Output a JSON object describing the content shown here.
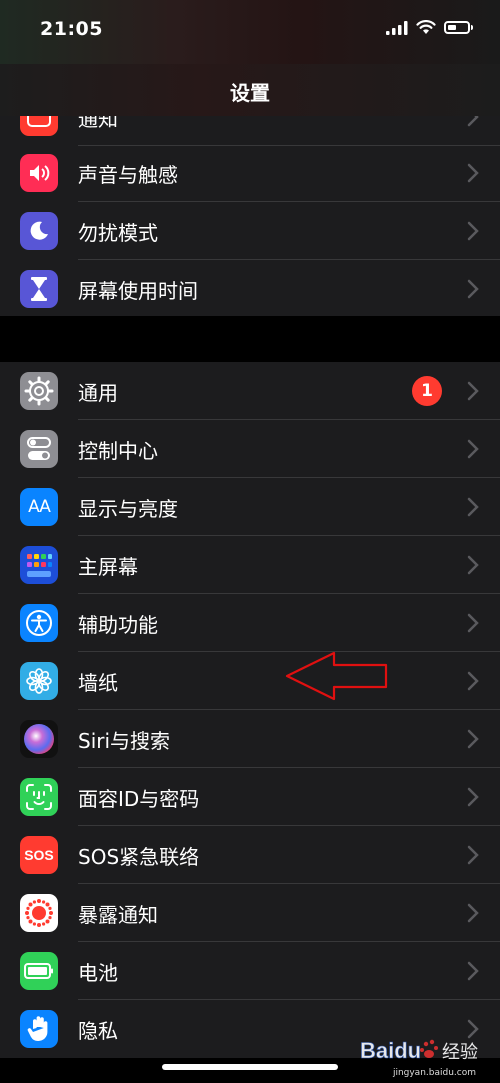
{
  "status_bar": {
    "time": "21:05"
  },
  "nav": {
    "title": "设置"
  },
  "group1": [
    {
      "label": "通知",
      "color": "#ff3b30",
      "icon": "notifications-icon"
    },
    {
      "label": "声音与触感",
      "color": "#ff2d55",
      "icon": "speaker-icon"
    },
    {
      "label": "勿扰模式",
      "color": "#5856d6",
      "icon": "moon-icon"
    },
    {
      "label": "屏幕使用时间",
      "color": "#5856d6",
      "icon": "hourglass-icon"
    }
  ],
  "group2": [
    {
      "label": "通用",
      "color": "#8e8e93",
      "icon": "gear-icon",
      "badge": "1"
    },
    {
      "label": "控制中心",
      "color": "#8e8e93",
      "icon": "toggles-icon"
    },
    {
      "label": "显示与亮度",
      "color": "#0a84ff",
      "icon": "text-size-icon",
      "icon_text": "AA"
    },
    {
      "label": "主屏幕",
      "color": "#1d4ed8",
      "icon": "home-screen-icon"
    },
    {
      "label": "辅助功能",
      "color": "#0a84ff",
      "icon": "accessibility-icon"
    },
    {
      "label": "墙纸",
      "color": "#32ade6",
      "icon": "flower-icon"
    },
    {
      "label": "Siri与搜索",
      "color": "#1a1a2e",
      "icon": "siri-icon"
    },
    {
      "label": "面容ID与密码",
      "color": "#30d158",
      "icon": "face-id-icon"
    },
    {
      "label": "SOS紧急联络",
      "color": "#ff3b30",
      "icon": "sos-icon",
      "icon_text": "SOS"
    },
    {
      "label": "暴露通知",
      "color": "#ffffff",
      "icon": "exposure-icon"
    },
    {
      "label": "电池",
      "color": "#30d158",
      "icon": "battery-icon"
    },
    {
      "label": "隐私",
      "color": "#0a84ff",
      "icon": "hand-icon"
    }
  ],
  "annotation": {
    "color": "#e01010",
    "icon": "arrow-left-icon"
  },
  "watermark": {
    "brand": "Baidu",
    "brand_cn": "经验",
    "url": "jingyan.baidu.com"
  }
}
